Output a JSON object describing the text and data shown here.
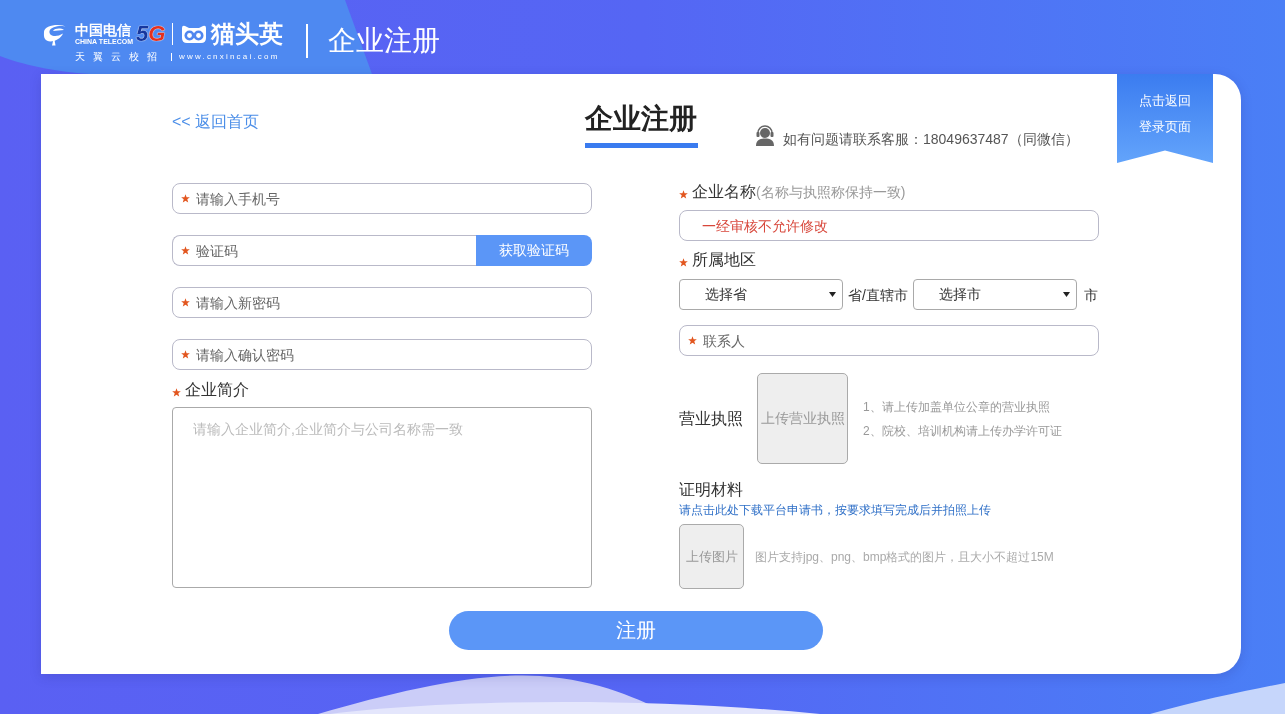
{
  "header": {
    "brand": {
      "name": "中国电信",
      "name_en": "CHINA TELECOM",
      "badge": "5G",
      "site": "猫头英",
      "slogan": "天翼云校招",
      "url": "www.cnxincai.com"
    },
    "title": "企业注册"
  },
  "card": {
    "back_link": "<< 返回首页",
    "title": "企业注册",
    "support": "如有问题请联系客服：18049637487（同微信）",
    "ribbon": "点击返回登录页面"
  },
  "account_fields": [
    {
      "kind": "text",
      "placeholder": "请输入手机号",
      "required": true
    },
    {
      "kind": "code",
      "placeholder": "验证码",
      "required": true,
      "button": "获取验证码"
    },
    {
      "kind": "text",
      "placeholder": "请输入新密码",
      "required": true
    },
    {
      "kind": "text",
      "placeholder": "请输入确认密码",
      "required": true
    }
  ],
  "intro": {
    "label": "企业简介",
    "required": true,
    "placeholder": "请输入企业简介,企业简介与公司名称需一致"
  },
  "company_name": {
    "label": "企业名称",
    "hint": "(名称与执照称保持一致)",
    "required": true,
    "placeholder": "一经审核不允许修改"
  },
  "region": {
    "label": "所属地区",
    "required": true,
    "province": {
      "value": "选择省",
      "suffix": "省/直辖市"
    },
    "city": {
      "value": "选择市",
      "suffix": "市"
    }
  },
  "contact": {
    "kind": "text",
    "placeholder": "联系人",
    "required": true
  },
  "business_license": {
    "label": "营业执照",
    "upload": "上传营业执照",
    "notes": [
      "1、请上传加盖单位公章的营业执照",
      "2、院校、培训机构请上传办学许可证"
    ]
  },
  "certificate": {
    "label": "证明材料",
    "link": "请点击此处下载平台申请书，按要求填写完成后并拍照上传",
    "upload": "上传图片",
    "note": "图片支持jpg、png、bmp格式的图片，且大小不超过15M"
  },
  "submit": "注册"
}
